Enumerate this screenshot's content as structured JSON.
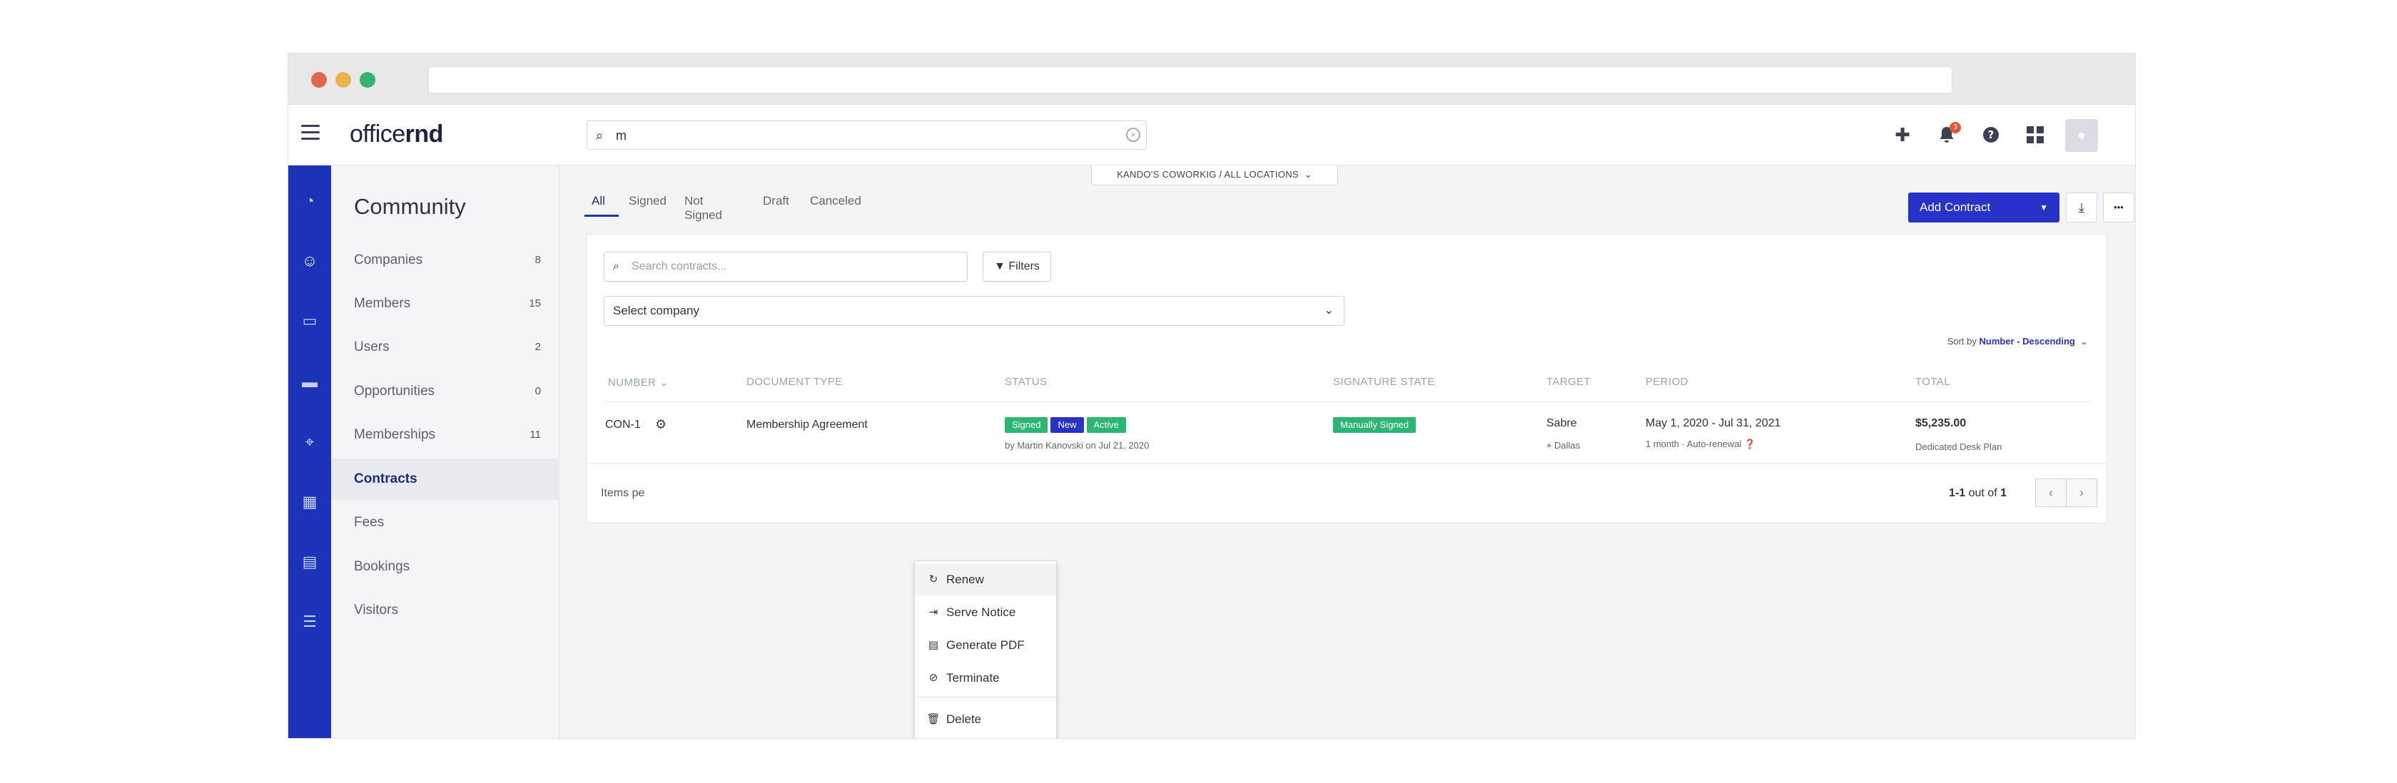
{
  "app": {
    "logo_light": "office",
    "logo_bold": "rnd",
    "notification_count": "3"
  },
  "search": {
    "value": "m",
    "clear_glyph": "×"
  },
  "header_icons": [
    "plus-icon",
    "bell-icon",
    "help-icon",
    "apps-icon",
    "avatar-icon"
  ],
  "sidebar": {
    "title": "Community",
    "items": [
      {
        "label": "Companies",
        "count": "8"
      },
      {
        "label": "Members",
        "count": "15"
      },
      {
        "label": "Users",
        "count": "2"
      },
      {
        "label": "Opportunities",
        "count": "0"
      },
      {
        "label": "Memberships",
        "count": "11"
      },
      {
        "label": "Contracts",
        "count": ""
      },
      {
        "label": "Fees",
        "count": ""
      },
      {
        "label": "Bookings",
        "count": ""
      },
      {
        "label": "Visitors",
        "count": ""
      }
    ],
    "active_item": "Contracts"
  },
  "rail_icons": [
    "dashboard-icon",
    "community-icon",
    "chat-icon",
    "billing-icon",
    "location-icon",
    "calendar-icon",
    "document-icon",
    "settings-sliders-icon"
  ],
  "location": {
    "label": "KANDO'S COWORKIG  /  ALL LOCATIONS",
    "chevron": "⌄"
  },
  "tabs": [
    "All",
    "Signed",
    "Not Signed",
    "Draft",
    "Canceled"
  ],
  "active_tab": "All",
  "toolbar": {
    "add_label": "Add Contract",
    "caret": "▼",
    "download_glyph": "⤓",
    "more_glyph": "•••"
  },
  "filters": {
    "search_placeholder": "Search contracts...",
    "filters_label": "Filters",
    "company_select": "Select company"
  },
  "sort": {
    "prefix": "Sort by ",
    "value": "Number - Descending"
  },
  "table": {
    "headers": [
      "NUMBER",
      "DOCUMENT TYPE",
      "STATUS",
      "SIGNATURE STATE",
      "TARGET",
      "PERIOD",
      "TOTAL"
    ],
    "number_header_chevron": "⌄",
    "row": {
      "number": "CON-1",
      "document_type": "Membership Agreement",
      "status_tags": [
        "Signed",
        "New",
        "Active"
      ],
      "status_by": "by Martin Kanovski on Jul 21, 2020",
      "signature_state": "Manually Signed",
      "target_name": "Sabre",
      "target_location": "Dallas",
      "period": "May 1, 2020 - Jul 31, 2021",
      "period_sub": "1 month  ·  Auto-renewal",
      "total": "$5,235.00",
      "plan": "Dedicated Desk Plan"
    }
  },
  "footer": {
    "items_per_page": "Items pe",
    "range_bold": "1-1",
    "range_mid": " out of ",
    "range_total": "1"
  },
  "context_menu": [
    {
      "label": "Renew",
      "icon": "renew-icon",
      "glyph": "↻"
    },
    {
      "label": "Serve Notice",
      "icon": "notice-icon",
      "glyph": "⇥"
    },
    {
      "label": "Generate PDF",
      "icon": "pdf-icon",
      "glyph": "▤"
    },
    {
      "label": "Terminate",
      "icon": "ban-icon",
      "glyph": "⊘"
    },
    {
      "label": "Delete",
      "icon": "trash-icon",
      "glyph": "🗑"
    }
  ]
}
